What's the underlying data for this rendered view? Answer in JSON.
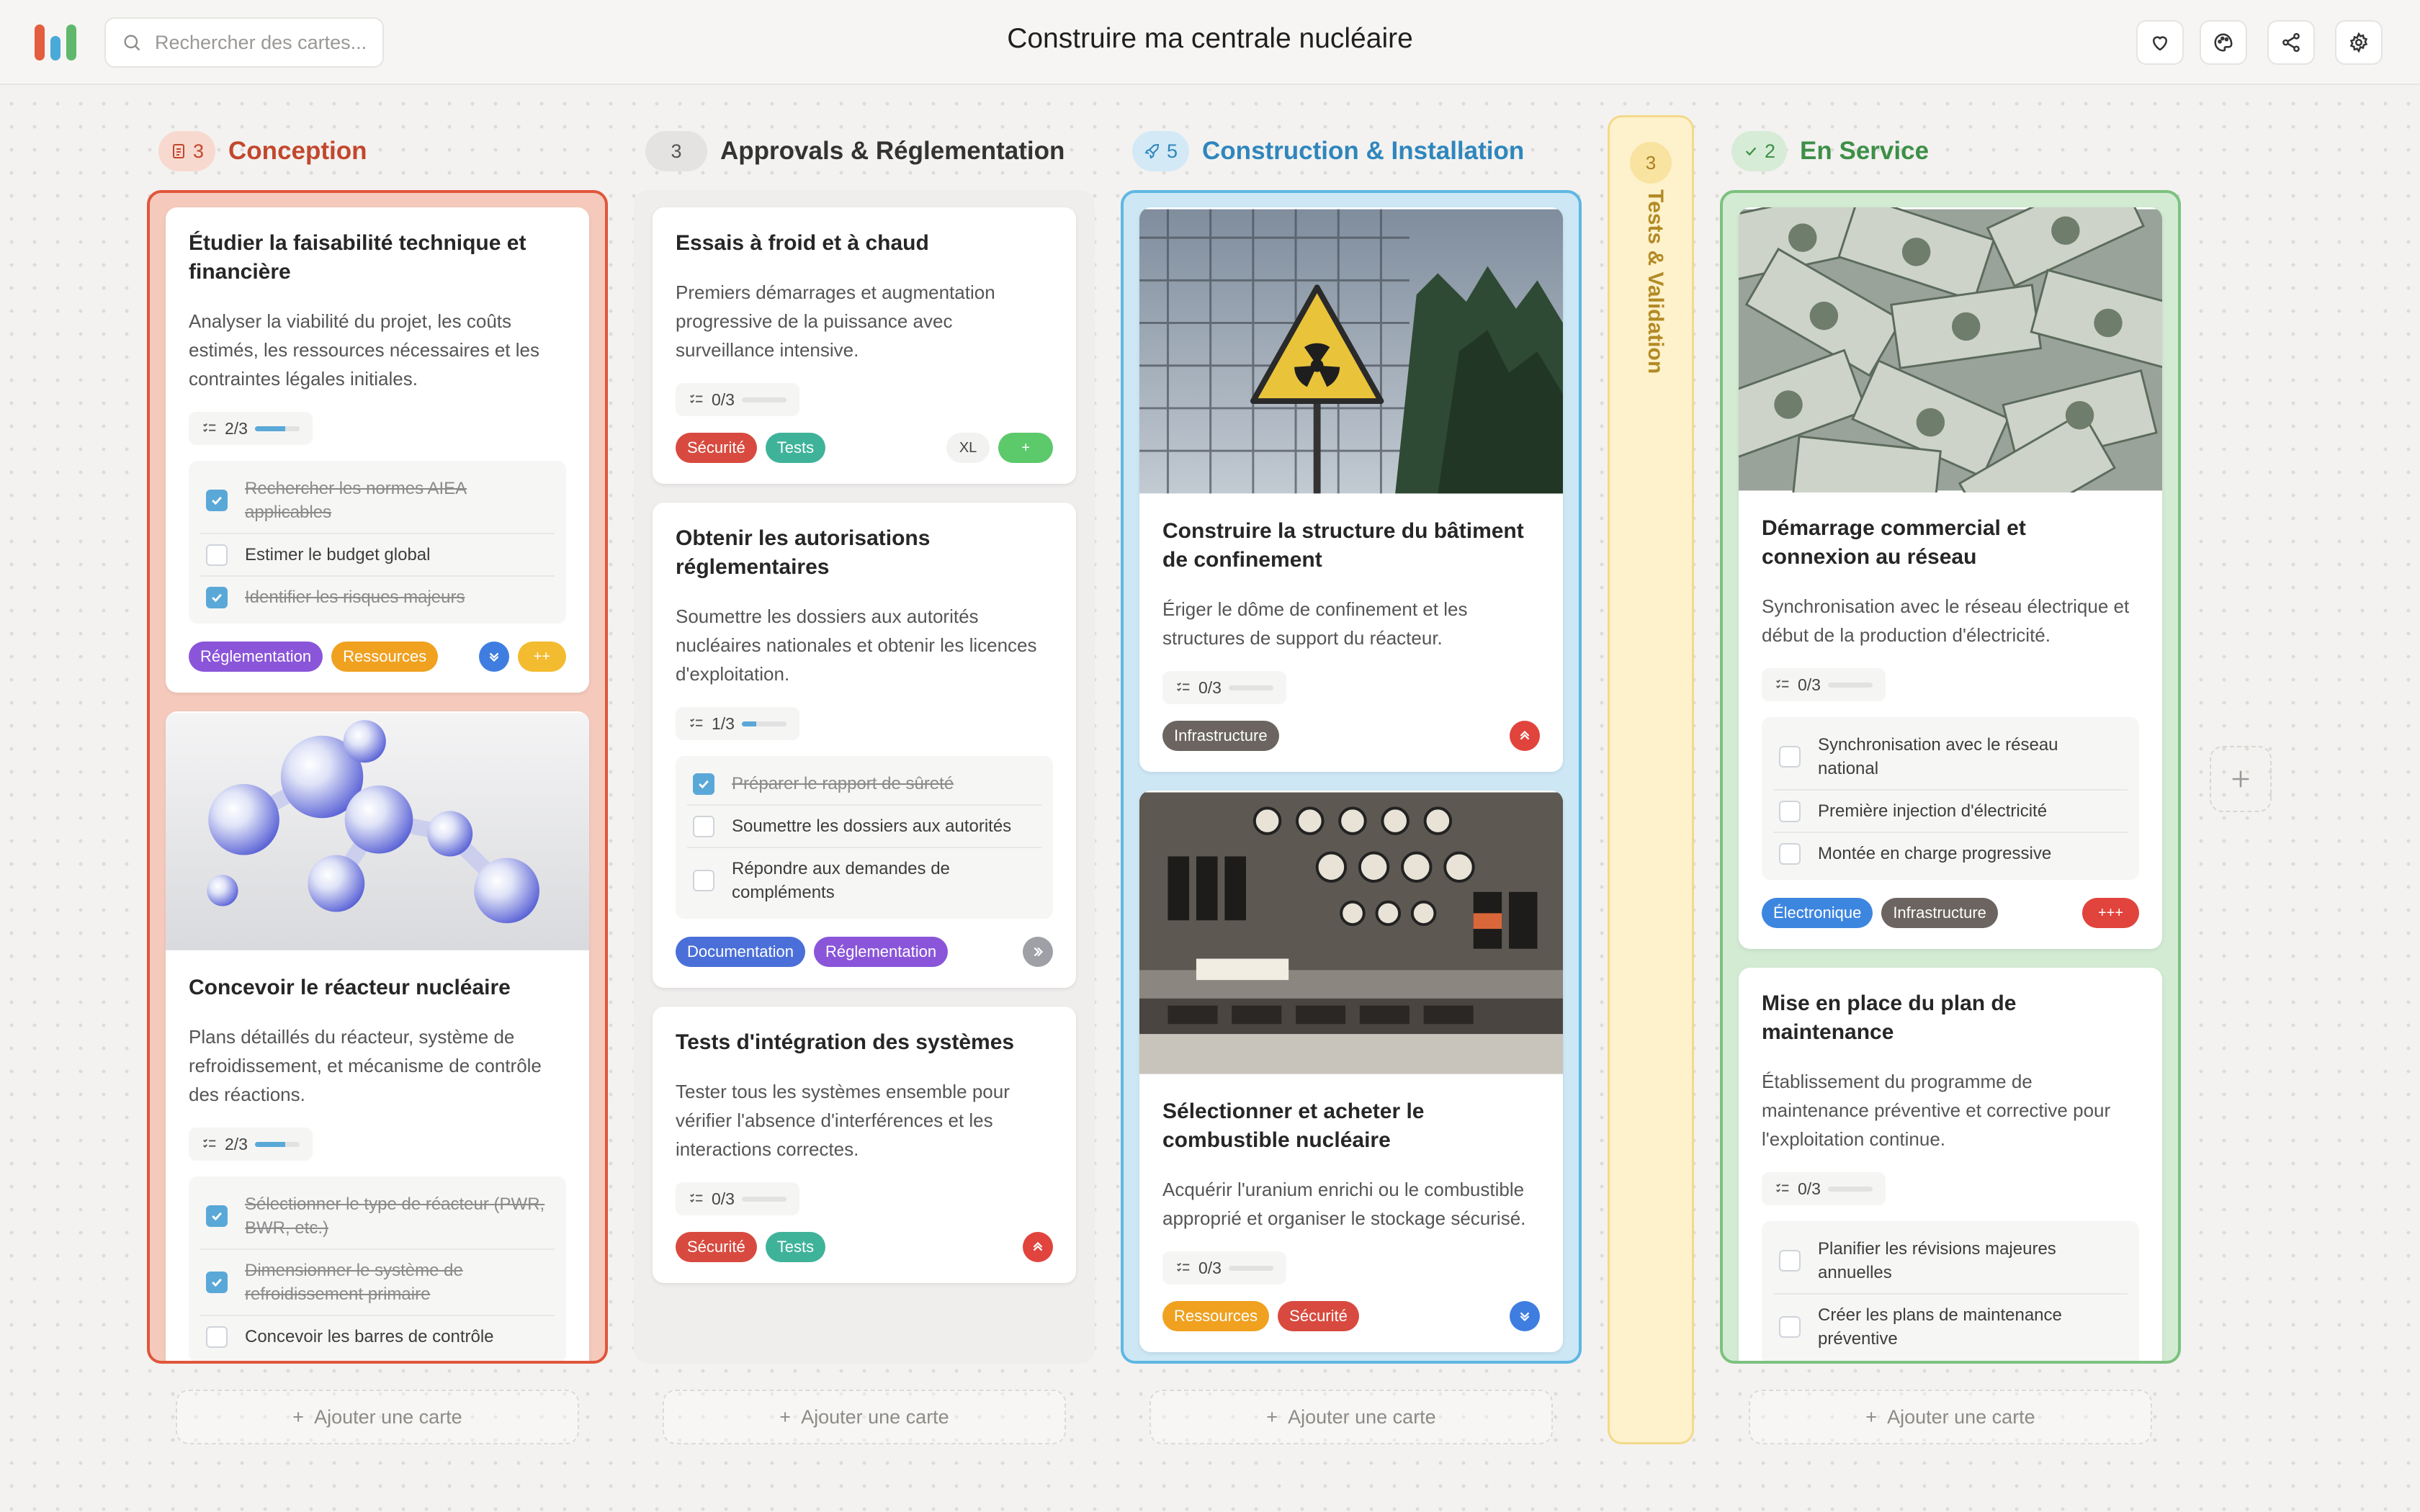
{
  "app": {
    "title": "Construire ma centrale nucléaire",
    "search_placeholder": "Rechercher des cartes...",
    "colors": {
      "logo": [
        "#e35d3f",
        "#49a9d9",
        "#5fb86d"
      ]
    }
  },
  "toolbar": {
    "icons": [
      "heart-icon",
      "palette-icon",
      "share-icon",
      "gear-icon"
    ]
  },
  "add_card_label": "Ajouter une carte",
  "columns": [
    {
      "name": "Conception",
      "count": "3",
      "icon": "document-icon",
      "color": "#e0563b",
      "cards": [
        {
          "title": "Étudier la faisabilité technique et financière",
          "desc": "Analyser la viabilité du projet, les coûts estimés, les ressources nécessaires et les contraintes légales initiales.",
          "progress": "2/3",
          "progress_value": 0.67,
          "checklist": [
            {
              "text": "Rechercher les normes AIEA applicables",
              "done": true
            },
            {
              "text": "Estimer le budget global",
              "done": false
            },
            {
              "text": "Identifier les risques majeurs",
              "done": true
            }
          ],
          "tags": [
            "Réglementation",
            "Ressources"
          ],
          "priority_icon": "chevrons-down-icon",
          "size": "++"
        },
        {
          "title": "Concevoir le réacteur nucléaire",
          "desc": "Plans détaillés du réacteur, système de refroidissement, et mécanisme de contrôle des réactions.",
          "progress": "2/3",
          "progress_value": 0.67,
          "image": "molecule-image",
          "checklist": [
            {
              "text": "Sélectionner le type de réacteur (PWR, BWR, etc.)",
              "done": true
            },
            {
              "text": "Dimensionner le système de refroidissement primaire",
              "done": true
            },
            {
              "text": "Concevoir les barres de contrôle",
              "done": false
            }
          ]
        }
      ]
    },
    {
      "name": "Approvals & Réglementation",
      "count": "3",
      "cards": [
        {
          "title": "Essais à froid et à chaud",
          "desc": "Premiers démarrages et augmentation progressive de la puissance avec surveillance intensive.",
          "progress": "0/3",
          "progress_value": 0,
          "tags": [
            "Sécurité",
            "Tests"
          ],
          "size": "XL",
          "size2": "+"
        },
        {
          "title": "Obtenir les autorisations réglementaires",
          "desc": "Soumettre les dossiers aux autorités nucléaires nationales et obtenir les licences d'exploitation.",
          "progress": "1/3",
          "progress_value": 0.33,
          "checklist": [
            {
              "text": "Préparer le rapport de sûreté",
              "done": true
            },
            {
              "text": "Soumettre les dossiers aux autorités",
              "done": false
            },
            {
              "text": "Répondre aux demandes de compléments",
              "done": false
            }
          ],
          "tags": [
            "Documentation",
            "Réglementation"
          ],
          "priority_icon": "chevrons-right-icon"
        },
        {
          "title": "Tests d'intégration des systèmes",
          "desc": "Tester tous les systèmes ensemble pour vérifier l'absence d'interférences et les interactions correctes.",
          "progress": "0/3",
          "progress_value": 0,
          "tags": [
            "Sécurité",
            "Tests"
          ],
          "priority_icon": "chevrons-up-icon"
        }
      ]
    },
    {
      "name": "Construction & Installation",
      "count": "5",
      "icon": "rocket-icon",
      "color": "#3a92c8",
      "cards": [
        {
          "title": "Construire la structure du bâtiment de confinement",
          "desc": "Ériger le dôme de confinement et les structures de support du réacteur.",
          "progress": "0/3",
          "progress_value": 0,
          "image": "radiation-sign-photo",
          "tags": [
            "Infrastructure"
          ],
          "priority_icon": "chevrons-up-icon"
        },
        {
          "title": "Sélectionner et acheter le combustible nucléaire",
          "desc": "Acquérir l'uranium enrichi ou le combustible approprié et organiser le stockage sécurisé.",
          "progress": "0/3",
          "progress_value": 0,
          "image": "control-panel-photo",
          "tags": [
            "Ressources",
            "Sécurité"
          ],
          "priority_icon": "chevrons-down-icon"
        }
      ]
    },
    {
      "name": "Tests & Validation",
      "count": "3",
      "collapsed": true,
      "color": "#c9a33a"
    },
    {
      "name": "En Service",
      "count": "2",
      "icon": "check-icon",
      "color": "#4ea55a",
      "cards": [
        {
          "title": "Démarrage commercial et connexion au réseau",
          "desc": "Synchronisation avec le réseau électrique et début de la production d'électricité.",
          "progress": "0/3",
          "progress_value": 0,
          "image": "dollar-bills-photo",
          "checklist": [
            {
              "text": "Synchronisation avec le réseau national",
              "done": false
            },
            {
              "text": "Première injection d'électricité",
              "done": false
            },
            {
              "text": "Montée en charge progressive",
              "done": false
            }
          ],
          "tags": [
            "Électronique",
            "Infrastructure"
          ],
          "size": "+++"
        },
        {
          "title": "Mise en place du plan de maintenance",
          "desc": "Établissement du programme de maintenance préventive et corrective pour l'exploitation continue.",
          "progress": "0/3",
          "progress_value": 0,
          "checklist": [
            {
              "text": "Planifier les révisions majeures annuelles",
              "done": false
            },
            {
              "text": "Créer les plans de maintenance préventive",
              "done": false
            }
          ]
        }
      ]
    }
  ]
}
